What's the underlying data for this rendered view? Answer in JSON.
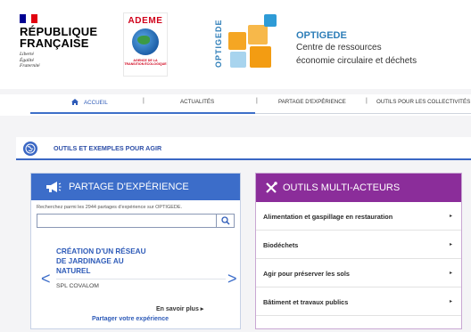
{
  "header": {
    "rf_name_line1": "RÉPUBLIQUE",
    "rf_name_line2": "FRANÇAISE",
    "rf_motto": [
      "Liberté",
      "Égalité",
      "Fraternité"
    ],
    "ademe_word": "ADEME",
    "ademe_sub": "AGENCE DE LA TRANSITION ÉCOLOGIQUE",
    "optigede_vertical": "OPTIGEDE",
    "optigede_title": "OPTIGEDE",
    "optigede_sub1": "Centre de ressources",
    "optigede_sub2": "économie circulaire et déchets"
  },
  "nav": {
    "items": [
      "ACCUEIL",
      "ACTUALITÉS",
      "PARTAGE D'EXPÉRIENCE",
      "OUTILS POUR LES COLLECTIVITÉS"
    ],
    "active_index": 0
  },
  "section": {
    "title": "OUTILS ET EXEMPLES POUR AGIR"
  },
  "left_card": {
    "title": "PARTAGE D'EXPÉRIENCE",
    "search_hint": "Recherchez parmi les 2944 partages d'expérience sur OPTIGEDE.",
    "search_value": "",
    "item_title_line1": "CRÉATION D'UN RÉSEAU",
    "item_title_line2": "DE JARDINAGE AU",
    "item_title_line3": "NATUREL",
    "item_org": "SPL COVALOM",
    "prev_arrow": "<",
    "next_arrow": ">",
    "more": "En savoir plus ▸",
    "share": "Partager votre expérience"
  },
  "right_card": {
    "title": "OUTILS MULTI-ACTEURS",
    "items": [
      "Alimentation et gaspillage en restauration",
      "Biodéchets",
      "Agir pour préserver les sols",
      "Bâtiment et travaux publics"
    ],
    "caret": "▸"
  },
  "colors": {
    "primary_blue": "#3c6dc9",
    "purple": "#8b2d9a",
    "link_blue": "#2e5bb8",
    "optigede_blue": "#2e7eb8",
    "ademe_red": "#d0021b"
  }
}
